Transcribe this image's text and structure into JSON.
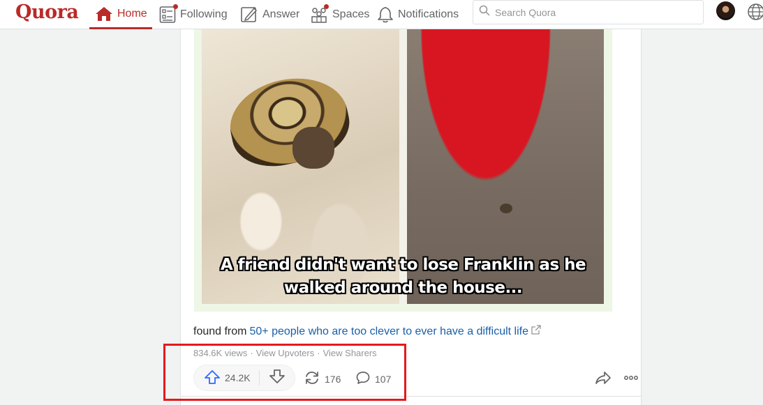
{
  "header": {
    "logo": "Quora",
    "nav": {
      "home": "Home",
      "following": "Following",
      "answer": "Answer",
      "spaces": "Spaces",
      "notifications": "Notifications"
    },
    "search_placeholder": "Search Quora",
    "brand_color": "#b92b27"
  },
  "post": {
    "image_caption_line1": "A friend didn't want to lose Franklin as he",
    "image_caption_line2": "walked around the house...",
    "found_from_prefix": "found from",
    "found_from_link": "50+ people who are too clever to ever have a difficult life",
    "views": "834.6K views",
    "sep1": "·",
    "view_upvoters": "View Upvoters",
    "sep2": "·",
    "view_sharers": "View Sharers",
    "upvotes": "24.2K",
    "reshares": "176",
    "comments": "107"
  },
  "icons": [
    "home-icon",
    "following-icon",
    "answer-icon",
    "spaces-icon",
    "bell-icon",
    "search-icon",
    "avatar",
    "globe-icon",
    "external-link-icon",
    "upvote-icon",
    "downvote-icon",
    "reshare-icon",
    "comment-icon",
    "share-icon",
    "more-icon"
  ],
  "annotation_color": "#e5191c"
}
